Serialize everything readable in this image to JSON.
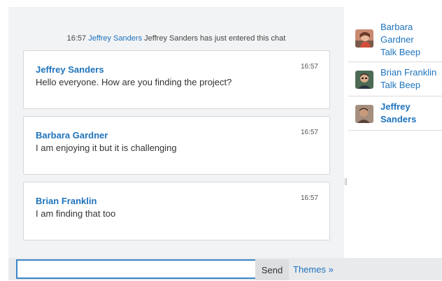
{
  "system_message": {
    "time": "16:57",
    "user": "Jeffrey Sanders",
    "text": "Jeffrey Sanders has just entered this chat"
  },
  "messages": [
    {
      "name": "Jeffrey Sanders",
      "time": "16:57",
      "text": "Hello everyone. How are you finding the project?"
    },
    {
      "name": "Barbara Gardner",
      "time": "16:57",
      "text": "I am enjoying it but it is challenging"
    },
    {
      "name": "Brian Franklin",
      "time": "16:57",
      "text": "I am finding that too"
    }
  ],
  "users": [
    {
      "line1": "Barbara",
      "line2": "Gardner",
      "action": "Talk Beep",
      "avatar": "avatar-photo-woman"
    },
    {
      "line1": "Brian Franklin",
      "action": "Talk Beep",
      "avatar": "avatar-photo-man"
    },
    {
      "line1": "Jeffrey",
      "line2": "Sanders",
      "avatar": "avatar-photo-man"
    }
  ],
  "input": {
    "value": "",
    "placeholder": ""
  },
  "send_label": "Send",
  "themes_label": "Themes »",
  "colors": {
    "link": "#1e73be",
    "panel_bg": "#f2f3f4",
    "input_border": "#3b85c6"
  }
}
